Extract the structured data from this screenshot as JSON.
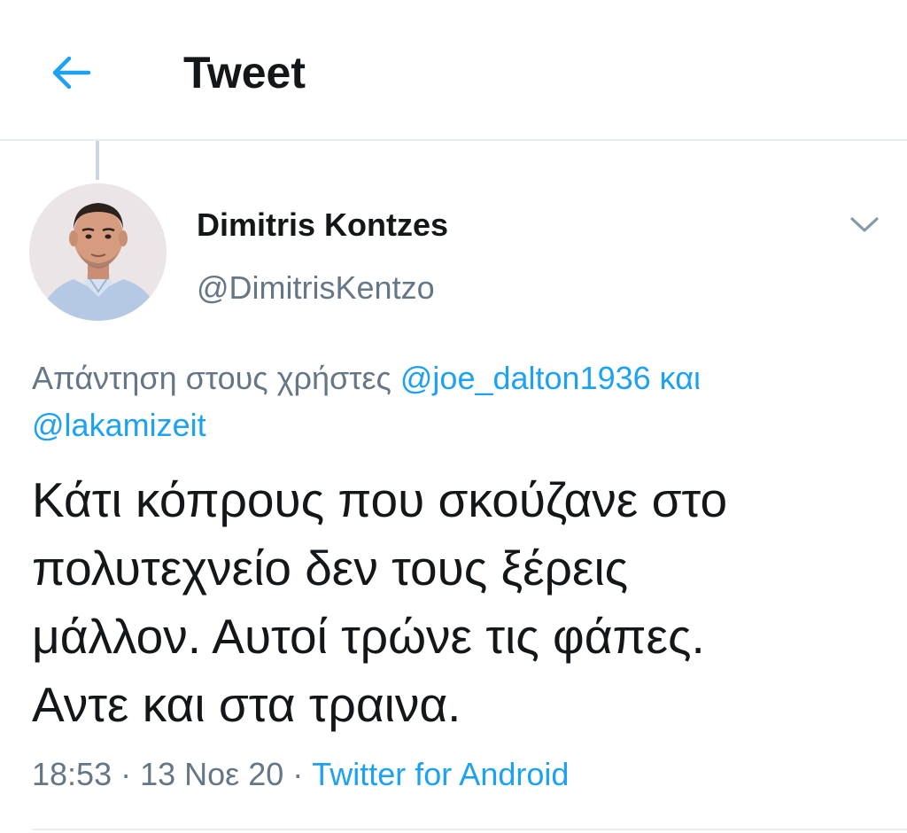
{
  "header": {
    "back_icon": "arrow-left-icon",
    "title": "Tweet"
  },
  "colors": {
    "accent": "#1da1f2",
    "text_primary": "#14171a",
    "text_secondary": "#657786",
    "divider": "#e6ecf0"
  },
  "tweet": {
    "author": {
      "name": "Dimitris Kontzes",
      "handle": "@DimitrisKentzo"
    },
    "menu_icon": "chevron-down-icon",
    "reply": {
      "prefix": "Απάντηση στους χρήστες ",
      "mention_1": "@joe_dalton1936",
      "connector": " και ",
      "mention_2": "@lakamizeit"
    },
    "text_lines": [
      "Κάτι κόπρους που σκούζανε στο",
      "πολυτεχνείο δεν τους ξέρεις",
      "μάλλον. Αυτοί τρώνε τις φάπες.",
      "Αντε και στα τραινα."
    ],
    "meta": {
      "time": "18:53",
      "separator": " · ",
      "date": "13 Νοε 20",
      "source": "Twitter for Android"
    }
  }
}
